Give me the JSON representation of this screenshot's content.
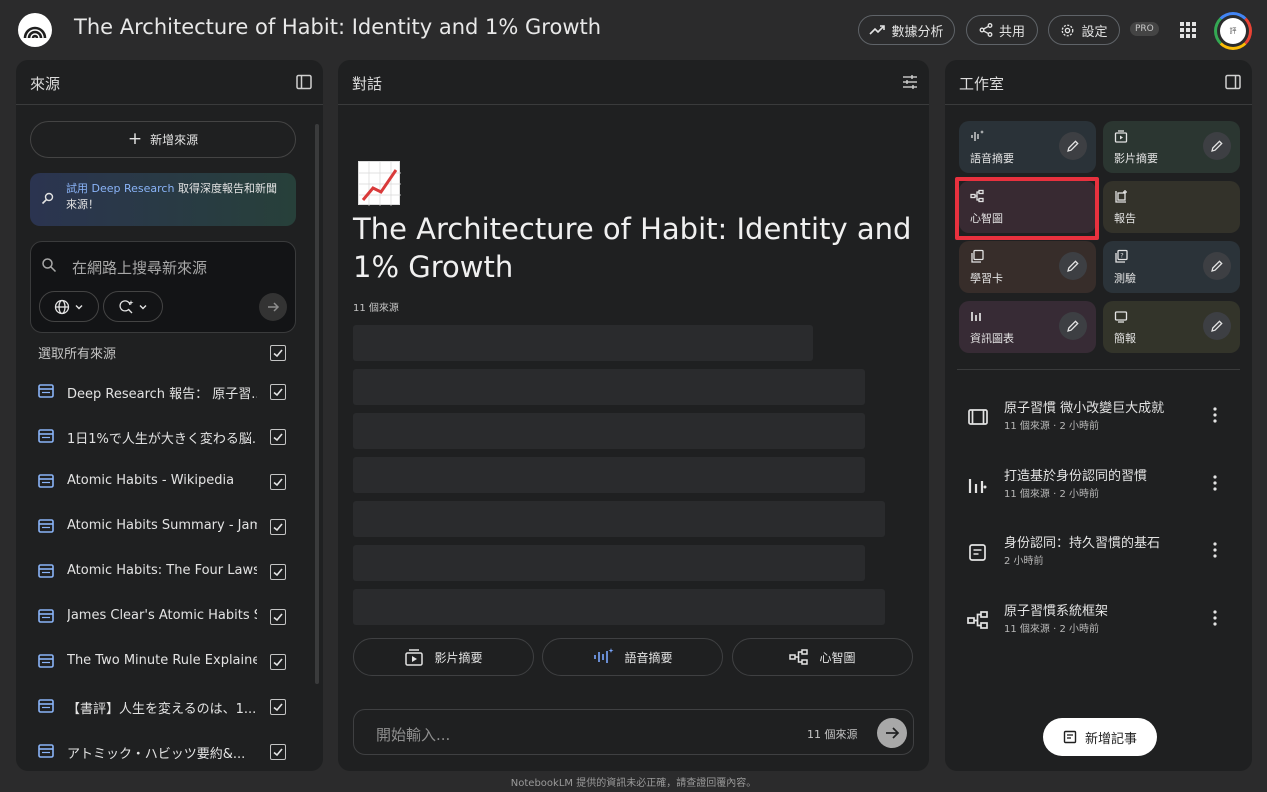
{
  "app": {
    "title": "The Architecture of Habit: Identity and 1% Growth",
    "header_buttons": [
      {
        "label": "數據分析",
        "icon": "trending-up-icon"
      },
      {
        "label": "共用",
        "icon": "share-icon"
      },
      {
        "label": "設定",
        "icon": "gear-icon"
      }
    ],
    "pro_badge": "PRO",
    "avatar_text": "評"
  },
  "sources": {
    "title": "來源",
    "add_label": "新增來源",
    "deep_research": {
      "prefix": "試用",
      "link": "Deep Research",
      "rest": "取得深度報告和新聞來源！"
    },
    "search_placeholder": "在網路上搜尋新來源",
    "select_all": "選取所有來源",
    "items": [
      {
        "label": "Deep Research 報告： 原子習...",
        "checked": true
      },
      {
        "label": "1日1%で人生が大きく変わる脳...",
        "checked": true
      },
      {
        "label": "Atomic Habits - Wikipedia",
        "checked": true
      },
      {
        "label": "Atomic Habits Summary - Jam...",
        "checked": true
      },
      {
        "label": "Atomic Habits: The Four Laws ...",
        "checked": true
      },
      {
        "label": "James Clear's Atomic Habits S...",
        "checked": true
      },
      {
        "label": "The Two Minute Rule Explaine...",
        "checked": true
      },
      {
        "label": "【書評】人生を変えるのは、1...",
        "checked": true
      },
      {
        "label": "アトミック・ハビッツ要約&...",
        "checked": true
      }
    ]
  },
  "chat": {
    "title": "對話",
    "doc_title": "The Architecture of Habit: Identity and 1% Growth",
    "source_count": "11 個來源",
    "quick_actions": [
      {
        "label": "影片摘要",
        "icon": "video-overview-icon"
      },
      {
        "label": "語音摘要",
        "icon": "audio-overview-icon"
      },
      {
        "label": "心智圖",
        "icon": "mind-map-icon"
      }
    ],
    "input_placeholder": "開始輸入...",
    "input_source_count": "11 個來源"
  },
  "studio": {
    "title": "工作室",
    "tiles": [
      {
        "label": "語音摘要",
        "icon": "audio-overview-icon"
      },
      {
        "label": "影片摘要",
        "icon": "video-overview-icon"
      },
      {
        "label": "心智圖",
        "icon": "mind-map-icon"
      },
      {
        "label": "報告",
        "icon": "report-icon"
      },
      {
        "label": "學習卡",
        "icon": "flashcards-icon"
      },
      {
        "label": "測驗",
        "icon": "quiz-icon"
      },
      {
        "label": "資訊圖表",
        "icon": "infographic-icon"
      },
      {
        "label": "簡報",
        "icon": "slides-icon"
      }
    ],
    "notes": [
      {
        "title": "原子習慣 微小改變巨大成就",
        "meta": "11 個來源 · 2 小時前",
        "icon": "video-icon"
      },
      {
        "title": "打造基於身份認同的習慣",
        "meta": "11 個來源 · 2 小時前",
        "icon": "infographic-icon"
      },
      {
        "title": "身份認同：持久習慣的基石",
        "meta": "2 小時前",
        "icon": "note-icon"
      },
      {
        "title": "原子習慣系統框架",
        "meta": "11 個來源 · 2 小時前",
        "icon": "mind-map-icon"
      }
    ],
    "add_note": "新增記事"
  },
  "footer": "NotebookLM 提供的資訊未必正確，請查證回覆內容。",
  "colors": {
    "background": "#2b2b2c",
    "panel": "#1f2021",
    "highlight": "#e8313e",
    "link": "#8ab4f8"
  }
}
